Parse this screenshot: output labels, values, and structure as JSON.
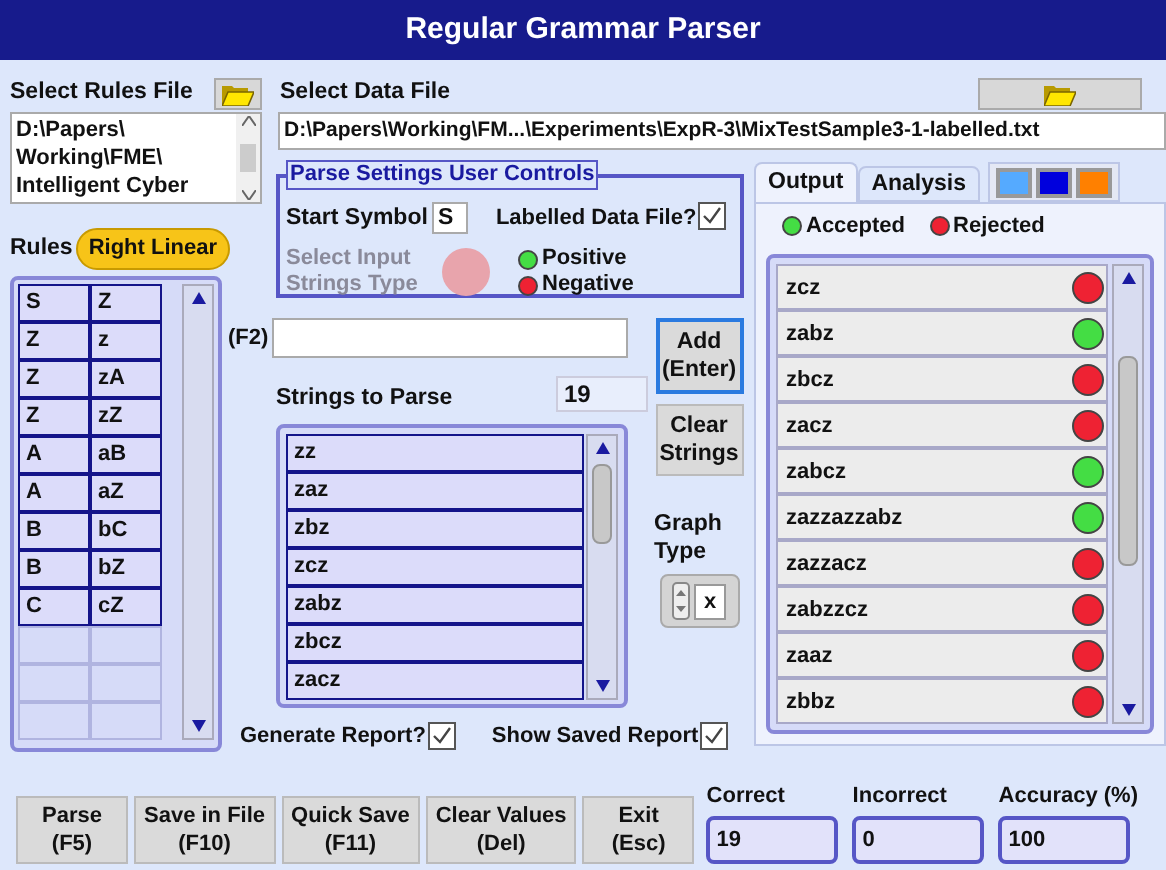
{
  "window": {
    "title": "Regular Grammar Parser"
  },
  "rules_file": {
    "label": "Select Rules File",
    "path_lines": [
      "D:\\Papers\\",
      "Working\\FME\\",
      "Intelligent Cyber"
    ]
  },
  "rules": {
    "label": "Rules",
    "badge": "Right Linear",
    "rows": [
      {
        "lhs": "S",
        "rhs": "Z"
      },
      {
        "lhs": "Z",
        "rhs": "z"
      },
      {
        "lhs": "Z",
        "rhs": "zA"
      },
      {
        "lhs": "Z",
        "rhs": "zZ"
      },
      {
        "lhs": "A",
        "rhs": "aB"
      },
      {
        "lhs": "A",
        "rhs": "aZ"
      },
      {
        "lhs": "B",
        "rhs": "bC"
      },
      {
        "lhs": "B",
        "rhs": "bZ"
      },
      {
        "lhs": "C",
        "rhs": "cZ"
      }
    ]
  },
  "data_file": {
    "label": "Select Data File",
    "path": "D:\\Papers\\Working\\FM...\\Experiments\\ExpR-3\\MixTestSample3-1-labelled.txt"
  },
  "parse_settings": {
    "title": "Parse Settings User Controls",
    "start_symbol_label": "Start Symbol",
    "start_symbol": "S",
    "labelled_label": "Labelled Data File?",
    "labelled_checked": true,
    "input_type_label": "Select Input Strings Type",
    "input_type_disabled": true,
    "legend": [
      {
        "label": "Positive",
        "color": "#44dd44"
      },
      {
        "label": "Negative",
        "color": "#ee2233"
      }
    ]
  },
  "entry": {
    "label": "(F2)"
  },
  "side_buttons": [
    {
      "label": "Add (Enter)",
      "focused": true
    },
    {
      "label": "Clear Strings",
      "focused": false
    }
  ],
  "strings": {
    "label": "Strings to Parse",
    "count": "19",
    "items": [
      "zz",
      "zaz",
      "zbz",
      "zcz",
      "zabz",
      "zbcz",
      "zacz"
    ]
  },
  "graph_type": {
    "label": "Graph Type",
    "value": "x"
  },
  "options": [
    {
      "label": "Generate Report?",
      "checked": true
    },
    {
      "label": "Show Saved Report",
      "checked": true
    }
  ],
  "tabs": [
    {
      "label": "Output",
      "selected": true
    },
    {
      "label": "Analysis",
      "selected": false
    }
  ],
  "swatches": [
    {
      "color": "#55aaff"
    },
    {
      "color": "#0000dd"
    },
    {
      "color": "#ff8000"
    }
  ],
  "output_legend": [
    {
      "label": "Accepted",
      "color": "#44dd44"
    },
    {
      "label": "Rejected",
      "color": "#ee2233"
    }
  ],
  "results": [
    {
      "string": "zcz",
      "accepted": false
    },
    {
      "string": "zabz",
      "accepted": true
    },
    {
      "string": "zbcz",
      "accepted": false
    },
    {
      "string": "zacz",
      "accepted": false
    },
    {
      "string": "zabcz",
      "accepted": true
    },
    {
      "string": "zazzazzabz",
      "accepted": true
    },
    {
      "string": "zazzacz",
      "accepted": false
    },
    {
      "string": "zabzzcz",
      "accepted": false
    },
    {
      "string": "zaaz",
      "accepted": false
    },
    {
      "string": "zbbz",
      "accepted": false
    }
  ],
  "actions": [
    {
      "label": "Parse",
      "key": "(F5)"
    },
    {
      "label": "Save in File",
      "key": "(F10)"
    },
    {
      "label": "Quick Save",
      "key": "(F11)"
    },
    {
      "label": "Clear Values",
      "key": "(Del)"
    },
    {
      "label": "Exit",
      "key": "(Esc)"
    }
  ],
  "stats": [
    {
      "label": "Correct",
      "value": "19"
    },
    {
      "label": "Incorrect",
      "value": "0"
    },
    {
      "label": "Accuracy (%)",
      "value": "100"
    }
  ]
}
